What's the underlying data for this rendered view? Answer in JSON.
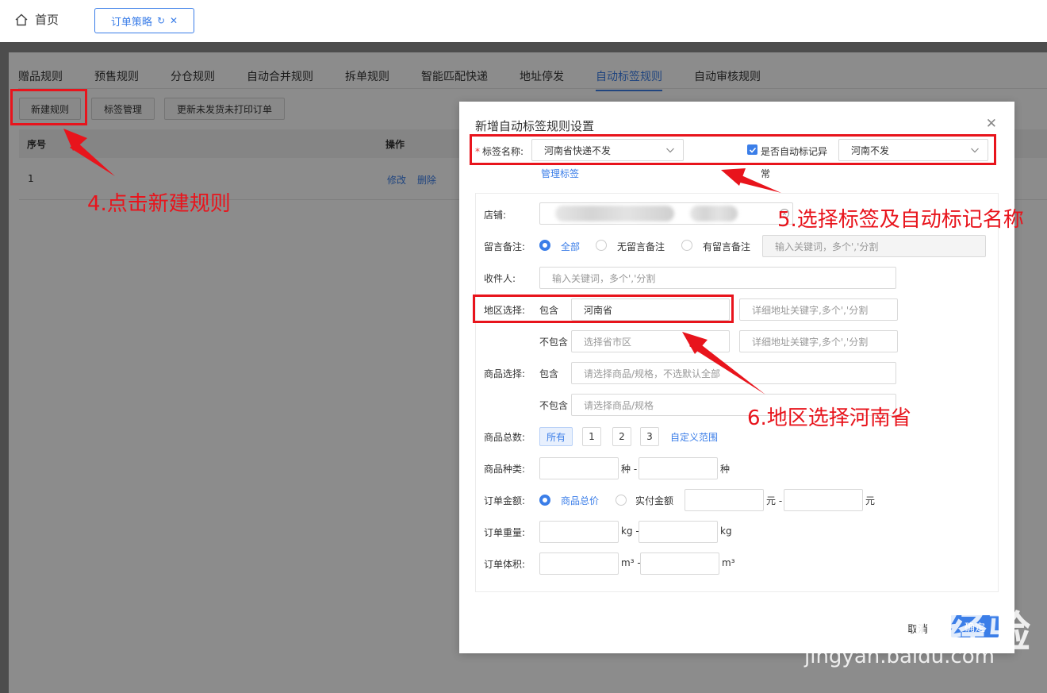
{
  "header": {
    "home_label": "首页",
    "open_tab_label": "订单策略"
  },
  "tabs": [
    {
      "label": "赠品规则",
      "active": false
    },
    {
      "label": "预售规则",
      "active": false
    },
    {
      "label": "分仓规则",
      "active": false
    },
    {
      "label": "自动合并规则",
      "active": false
    },
    {
      "label": "拆单规则",
      "active": false
    },
    {
      "label": "智能匹配快递",
      "active": false
    },
    {
      "label": "地址停发",
      "active": false
    },
    {
      "label": "自动标签规则",
      "active": true
    },
    {
      "label": "自动审核规则",
      "active": false
    }
  ],
  "toolbar": {
    "new_rule": "新建规则",
    "tag_manage": "标签管理",
    "update_unprinted": "更新未发货未打印订单"
  },
  "table": {
    "col_index": "序号",
    "col_ops": "操作",
    "rows": [
      {
        "index": "1",
        "edit": "修改",
        "delete": "删除"
      }
    ]
  },
  "dialog": {
    "title": "新增自动标签规则设置",
    "tag_name_label": "标签名称:",
    "tag_name_value": "河南省快递不发",
    "manage_tags": "管理标签",
    "auto_mark_label": "是否自动标记异",
    "auto_mark_label_cont": "常",
    "auto_mark_checked": true,
    "auto_mark_value": "河南不发",
    "shop_label": "店铺:",
    "remark_label": "留言备注:",
    "remark_opts": [
      "全部",
      "无留言备注",
      "有留言备注"
    ],
    "remark_selected": "全部",
    "remark_placeholder": "输入关键词，多个','分割",
    "receiver_label": "收件人:",
    "receiver_placeholder": "输入关键词，多个','分割",
    "region_label": "地区选择:",
    "include": "包含",
    "exclude": "不包含",
    "region_value": "河南省",
    "region_ex_placeholder": "选择省市区",
    "addr_kw_placeholder": "详细地址关键字,多个','分割",
    "goods_label": "商品选择:",
    "goods_inc_placeholder": "请选择商品/规格，不选默认全部",
    "goods_ex_placeholder": "请选择商品/规格",
    "goods_total_label": "商品总数:",
    "goods_total_opts": [
      "所有",
      "1",
      "2",
      "3"
    ],
    "custom_range": "自定义范围",
    "goods_kinds_label": "商品种类:",
    "unit_kind": "种",
    "order_amount_label": "订单金额:",
    "amount_opts": [
      "商品总价",
      "实付金额"
    ],
    "amount_selected": "商品总价",
    "unit_yuan": "元",
    "order_weight_label": "订单重量:",
    "unit_kg": "kg",
    "order_volume_label": "订单体积:",
    "unit_m3": "m³",
    "dash": "-",
    "cancel": "取消",
    "ok": "确定"
  },
  "annotations": {
    "step4": "4.点击新建规则",
    "step5": "5.选择标签及自动标记名称",
    "step6": "6.地区选择河南省"
  },
  "watermark": {
    "brand": "Baidu经验",
    "url": "jingyan.baidu.com"
  },
  "colors": {
    "primary": "#3b7ee8",
    "annotation_red": "#e8141c",
    "mask": "rgba(0,0,0,0.45)"
  }
}
